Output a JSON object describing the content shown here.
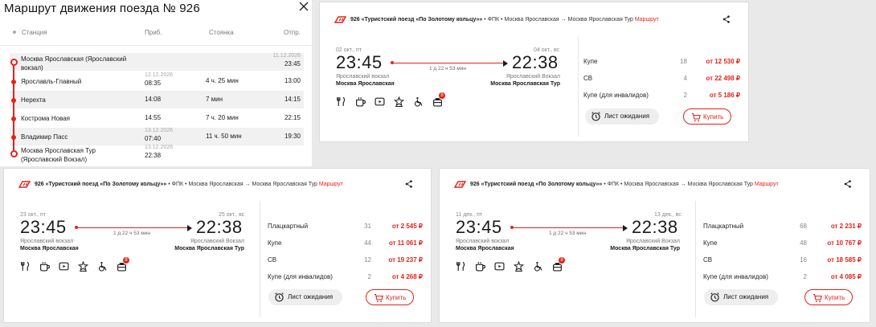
{
  "route_panel": {
    "title": "Маршрут движения поезда № 926",
    "headers": {
      "station": "Станция",
      "arrival": "Приб.",
      "stop": "Стоянка",
      "departure": "Отпр."
    },
    "stations": [
      {
        "name_line1": "Москва Ярославская (Ярославский",
        "name_line2": "вокзал)",
        "arrival_date": "",
        "arrival_time": "",
        "stop": "",
        "departure_date": "11.12.2026",
        "departure_time": "23:45"
      },
      {
        "name_line1": "Ярославль-Главный",
        "name_line2": "",
        "arrival_date": "12.12.2026",
        "arrival_time": "08:35",
        "stop": "4 ч. 25 мин",
        "departure_date": "",
        "departure_time": "13:00"
      },
      {
        "name_line1": "Нерехта",
        "name_line2": "",
        "arrival_date": "",
        "arrival_time": "14:08",
        "stop": "7 мин",
        "departure_date": "",
        "departure_time": "14:15"
      },
      {
        "name_line1": "Кострома Новая",
        "name_line2": "",
        "arrival_date": "",
        "arrival_time": "14:55",
        "stop": "7 ч. 20 мин",
        "departure_date": "",
        "departure_time": "22:15"
      },
      {
        "name_line1": "Владимир Пасс",
        "name_line2": "",
        "arrival_date": "13.12.2026",
        "arrival_time": "07:40",
        "stop": "11 ч. 50 мин",
        "departure_date": "",
        "departure_time": "19:30"
      },
      {
        "name_line1": "Москва Ярославская Тур",
        "name_line2": "(Ярославский Вокзал)",
        "arrival_date": "13.12.2026",
        "arrival_time": "22:38",
        "stop": "",
        "departure_date": "",
        "departure_time": ""
      }
    ]
  },
  "card_common": {
    "train_number": "926",
    "train_name": "«Туристский поезд «По Золотому кольцу»»",
    "carrier": "ФПК",
    "from": "Москва Ярославская",
    "arrow": "→",
    "to": "Москва Ярославская Тур",
    "route_link": "Маршрут",
    "dep_time": "23:45",
    "arr_time": "22:38",
    "duration": "1 д 22 ч 53 мин",
    "dep_station_small": "Ярославский вокзал",
    "dep_station_bold": "Москва Ярославская",
    "arr_station_small": "Ярославский Вокзал",
    "arr_station_bold": "Москва Ярославская Тур",
    "badge_count": "8",
    "wait_label": "Лист ожидания",
    "buy_label": "Купить",
    "amenities": [
      "cutlery-icon",
      "coffee-icon",
      "video-icon",
      "star-icon",
      "wheelchair-icon",
      "luggage-icon"
    ]
  },
  "cards": [
    {
      "dep_date": "02 окт., пт",
      "arr_date": "04 окт., вс",
      "classes": [
        {
          "name": "Купе",
          "count": "18",
          "price": "от 12 530 ₽"
        },
        {
          "name": "СВ",
          "count": "4",
          "price": "от 22 498 ₽"
        },
        {
          "name": "Купе (для инвалидов)",
          "count": "2",
          "price": "от 5 186 ₽"
        }
      ]
    },
    {
      "dep_date": "23 окт., пт",
      "arr_date": "25 окт., вс",
      "classes": [
        {
          "name": "Плацкартный",
          "count": "31",
          "price": "от 2 545 ₽"
        },
        {
          "name": "Купе",
          "count": "44",
          "price": "от 11 061 ₽"
        },
        {
          "name": "СВ",
          "count": "12",
          "price": "от 19 237 ₽"
        },
        {
          "name": "Купе (для инвалидов)",
          "count": "2",
          "price": "от 4 268 ₽"
        }
      ]
    },
    {
      "dep_date": "11 дек., пт",
      "arr_date": "13 дек., вс",
      "classes": [
        {
          "name": "Плацкартный",
          "count": "68",
          "price": "от 2 231 ₽"
        },
        {
          "name": "Купе",
          "count": "48",
          "price": "от 10 767 ₽"
        },
        {
          "name": "СВ",
          "count": "16",
          "price": "от 18 585 ₽"
        },
        {
          "name": "Купе (для инвалидов)",
          "count": "2",
          "price": "от 4 085 ₽"
        }
      ]
    }
  ],
  "colors": {
    "accent": "#e2231a",
    "text": "#1a1a1a",
    "muted": "#888888",
    "row_shade": "#f1f1f1"
  }
}
